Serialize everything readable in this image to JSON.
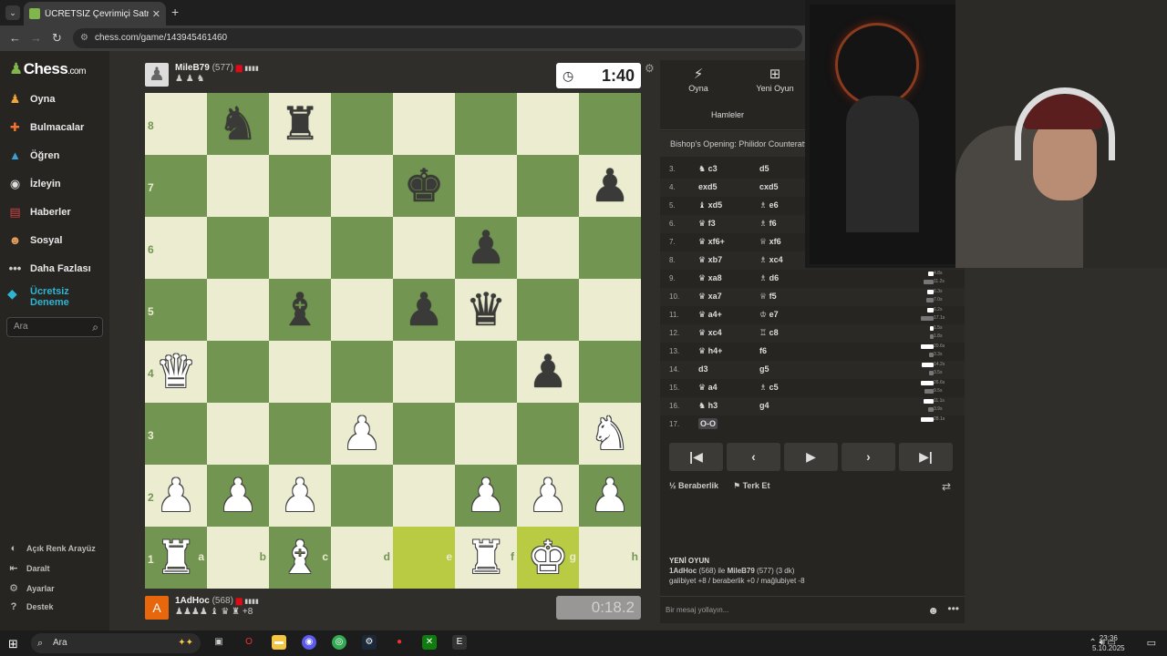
{
  "browser": {
    "tab_title": "ÜCRETSİZ Çevrimiçi Satranç Oy…",
    "url": "chess.com/game/143945461460"
  },
  "sidebar": {
    "logo": "Chess",
    "logo_suffix": ".com",
    "items": [
      {
        "label": "Oyna",
        "icon": "play-icon"
      },
      {
        "label": "Bulmacalar",
        "icon": "puzzle-icon"
      },
      {
        "label": "Öğren",
        "icon": "learn-icon"
      },
      {
        "label": "İzleyin",
        "icon": "watch-icon"
      },
      {
        "label": "Haberler",
        "icon": "news-icon"
      },
      {
        "label": "Sosyal",
        "icon": "social-icon"
      },
      {
        "label": "Daha Fazlası",
        "icon": "more-icon"
      }
    ],
    "trial": "Ücretsiz Deneme",
    "search_placeholder": "Ara",
    "footer": [
      {
        "label": "Açık Renk Arayüz",
        "icon": "theme-icon"
      },
      {
        "label": "Daralt",
        "icon": "collapse-icon"
      },
      {
        "label": "Ayarlar",
        "icon": "settings-icon"
      },
      {
        "label": "Destek",
        "icon": "help-icon"
      }
    ]
  },
  "opponent": {
    "name": "MileB79",
    "rating": "(577)",
    "flag": "RS",
    "captured": "♟ ♟ ♞"
  },
  "player": {
    "name": "1AdHoc",
    "rating": "(568)",
    "flag": "TR",
    "captured": "♟♟♟♟ ♝ ♛ ♜",
    "advantage": "+8",
    "avatar_letter": "A",
    "avatar_color": "#e8670c"
  },
  "clock_top": "1:40",
  "clock_bottom": "0:18.2",
  "board": {
    "light": "#ebecd0",
    "dark": "#739552",
    "highlight": "#b9ca43",
    "ranks": [
      "8",
      "7",
      "6",
      "5",
      "4",
      "3",
      "2",
      "1"
    ],
    "files": [
      "a",
      "b",
      "c",
      "d",
      "e",
      "f",
      "g",
      "h"
    ],
    "position": [
      [
        "",
        "bN",
        "bR",
        "",
        "",
        "",
        "",
        ""
      ],
      [
        "",
        "",
        "",
        "",
        "bK",
        "",
        "",
        "bP"
      ],
      [
        "",
        "",
        "",
        "",
        "",
        "bP",
        "",
        ""
      ],
      [
        "",
        "",
        "bB",
        "",
        "bP",
        "bQ",
        "",
        ""
      ],
      [
        "wQ",
        "",
        "",
        "",
        "",
        "",
        "bP",
        ""
      ],
      [
        "",
        "",
        "",
        "wP",
        "",
        "",
        "",
        "wN"
      ],
      [
        "wP",
        "wP",
        "wP",
        "",
        "",
        "wP",
        "wP",
        "wP"
      ],
      [
        "wR",
        "",
        "wB",
        "",
        "",
        "wR",
        "wK",
        ""
      ]
    ],
    "highlighted": [
      "e1",
      "g1"
    ]
  },
  "panel": {
    "tab_play": "Oyna",
    "tab_new": "Yeni Oyun",
    "tab_moves": "Hamleler",
    "opening": "Bishop's Opening: Philidor Counteratta",
    "moves": [
      {
        "n": "3.",
        "w": "c3",
        "wp": "♞",
        "b": "d5",
        "bp": "",
        "tw": "",
        "tb": ""
      },
      {
        "n": "4.",
        "w": "exd5",
        "wp": "",
        "b": "cxd5",
        "bp": "",
        "tw": "",
        "tb": ""
      },
      {
        "n": "5.",
        "w": "xd5",
        "wp": "♝",
        "b": "e6",
        "bp": "♗",
        "tw": "",
        "tb": ""
      },
      {
        "n": "6.",
        "w": "f3",
        "wp": "♛",
        "b": "f6",
        "bp": "♗",
        "tw": "",
        "tb": ""
      },
      {
        "n": "7.",
        "w": "xf6+",
        "wp": "♛",
        "b": "xf6",
        "bp": "♕",
        "tw": "",
        "tb": ""
      },
      {
        "n": "8.",
        "w": "xb7",
        "wp": "♛",
        "b": "xc4",
        "bp": "♗",
        "tw": "",
        "tb": ""
      },
      {
        "n": "9.",
        "w": "xa8",
        "wp": "♛",
        "b": "d6",
        "bp": "♗",
        "tw": "4.8s",
        "tb": "11.2s"
      },
      {
        "n": "10.",
        "w": "xa7",
        "wp": "♛",
        "b": "f5",
        "bp": "♕",
        "tw": "6.3s",
        "tb": "7.0s"
      },
      {
        "n": "11.",
        "w": "a4+",
        "wp": "♛",
        "b": "e7",
        "bp": "♔",
        "tw": "6.2s",
        "tb": "17.1s"
      },
      {
        "n": "12.",
        "w": "xc4",
        "wp": "♛",
        "b": "c8",
        "bp": "♖",
        "tw": "1.5s",
        "tb": "1.8s"
      },
      {
        "n": "13.",
        "w": "h4+",
        "wp": "♛",
        "b": "f6",
        "bp": "",
        "tw": "20.6s",
        "tb": "3.3s"
      },
      {
        "n": "14.",
        "w": "d3",
        "wp": "",
        "b": "g5",
        "bp": "",
        "tw": "14.2s",
        "tb": "3.5s"
      },
      {
        "n": "15.",
        "w": "a4",
        "wp": "♛",
        "b": "c5",
        "bp": "♗",
        "tw": "26.6s",
        "tb": "9.5s"
      },
      {
        "n": "16.",
        "w": "h3",
        "wp": "♞",
        "b": "g4",
        "bp": "",
        "tw": "11.1s",
        "tb": "3.9s"
      },
      {
        "n": "17.",
        "w": "O-O",
        "wp": "",
        "b": "",
        "bp": "",
        "tw": "28.1s",
        "tb": ""
      }
    ],
    "draw": "Beraberlik",
    "resign": "Terk Et",
    "new_game_title": "YENİ OYUN",
    "new_game_line1_a": "1AdHoc",
    "new_game_line1_b": " (568) ile ",
    "new_game_line1_c": "MileB79",
    "new_game_line1_d": " (577) (3 dk)",
    "new_game_line2": "galibiyet +8 / beraberlik +0 / mağlubiyet -8",
    "chat_placeholder": "Bir mesaj yollayın..."
  },
  "taskbar": {
    "search": "Ara",
    "time": "23:36",
    "date": "5.10.2025"
  }
}
